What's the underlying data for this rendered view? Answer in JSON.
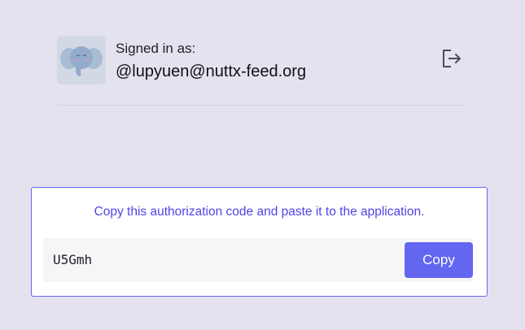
{
  "account": {
    "signed_in_label": "Signed in as:",
    "handle": "@lupyuen@nuttx-feed.org",
    "avatar_icon": "elephant-avatar-icon",
    "logout_icon": "logout-icon"
  },
  "authorization": {
    "instruction": "Copy this authorization code and paste it to the application.",
    "code_value": "U5Gmh",
    "copy_label": "Copy"
  },
  "colors": {
    "page_background": "#e4e2ef",
    "accent": "#6366f1",
    "instruction_text": "#4f46e5",
    "avatar_background": "#d3d9e4"
  }
}
